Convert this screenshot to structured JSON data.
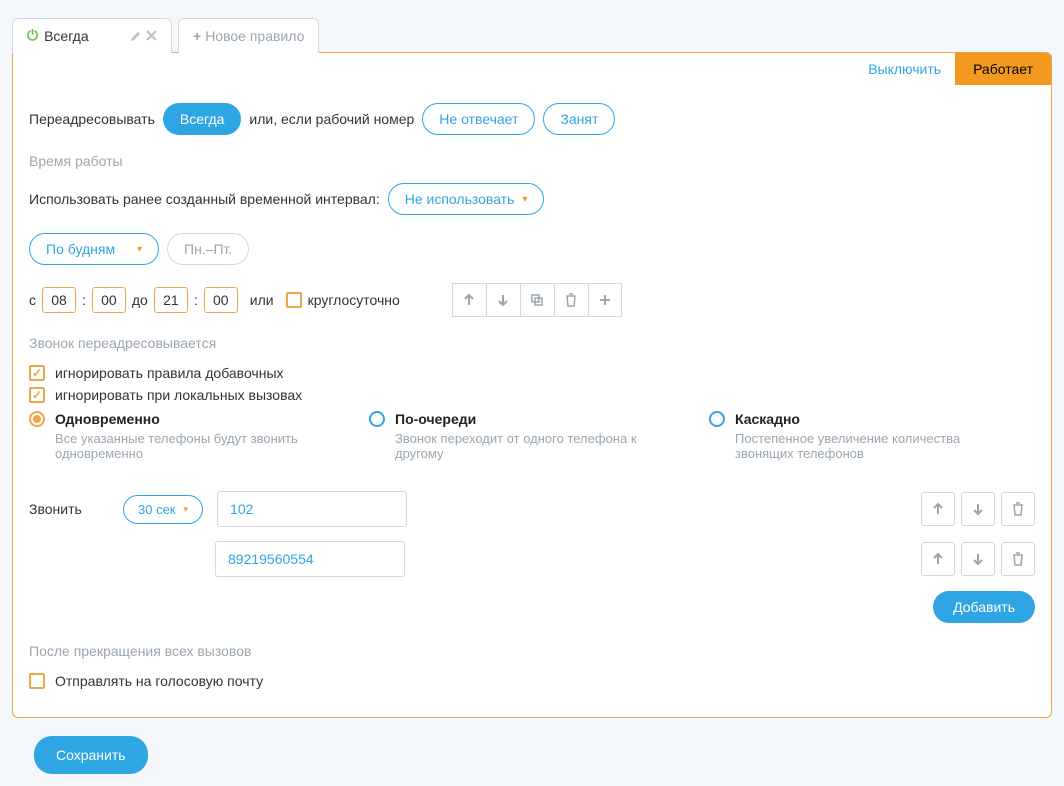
{
  "tabs": {
    "active": {
      "label": "Всегда"
    },
    "new": {
      "label": "Новое правило"
    }
  },
  "header": {
    "disable_link": "Выключить",
    "status": "Работает"
  },
  "forward": {
    "label": "Переадресовывать",
    "always": "Всегда",
    "or_if": "или, если рабочий номер",
    "no_answer": "Не отвечает",
    "busy": "Занят"
  },
  "worktime": {
    "section": "Время работы",
    "use_interval_label": "Использовать ранее созданный временной интервал:",
    "dont_use": "Не использовать",
    "weekdays_drop": "По будням",
    "weekdays_range": "Пн.–Пт.",
    "from": "с",
    "to": "до",
    "or": "или",
    "h_from": "08",
    "m_from": "00",
    "h_to": "21",
    "m_to": "00",
    "round_clock": "круглосуточно"
  },
  "redirect": {
    "section": "Звонок переадресовывается",
    "ignore_ext": "игнорировать правила добавочных",
    "ignore_local": "игнорировать при локальных вызовах",
    "opt1": {
      "title": "Одновременно",
      "desc": "Все указанные телефоны будут звонить одновременно"
    },
    "opt2": {
      "title": "По-очереди",
      "desc": "Звонок переходит от одного телефона к другому"
    },
    "opt3": {
      "title": "Каскадно",
      "desc": "Постепенное увеличение количества звонящих телефонов"
    }
  },
  "call": {
    "label": "Звонить",
    "duration": "30 сек",
    "numbers": [
      "102",
      "89219560554"
    ],
    "add": "Добавить"
  },
  "after": {
    "section": "После прекращения всех вызовов",
    "voicemail": "Отправлять на голосовую почту"
  },
  "save": "Сохранить"
}
